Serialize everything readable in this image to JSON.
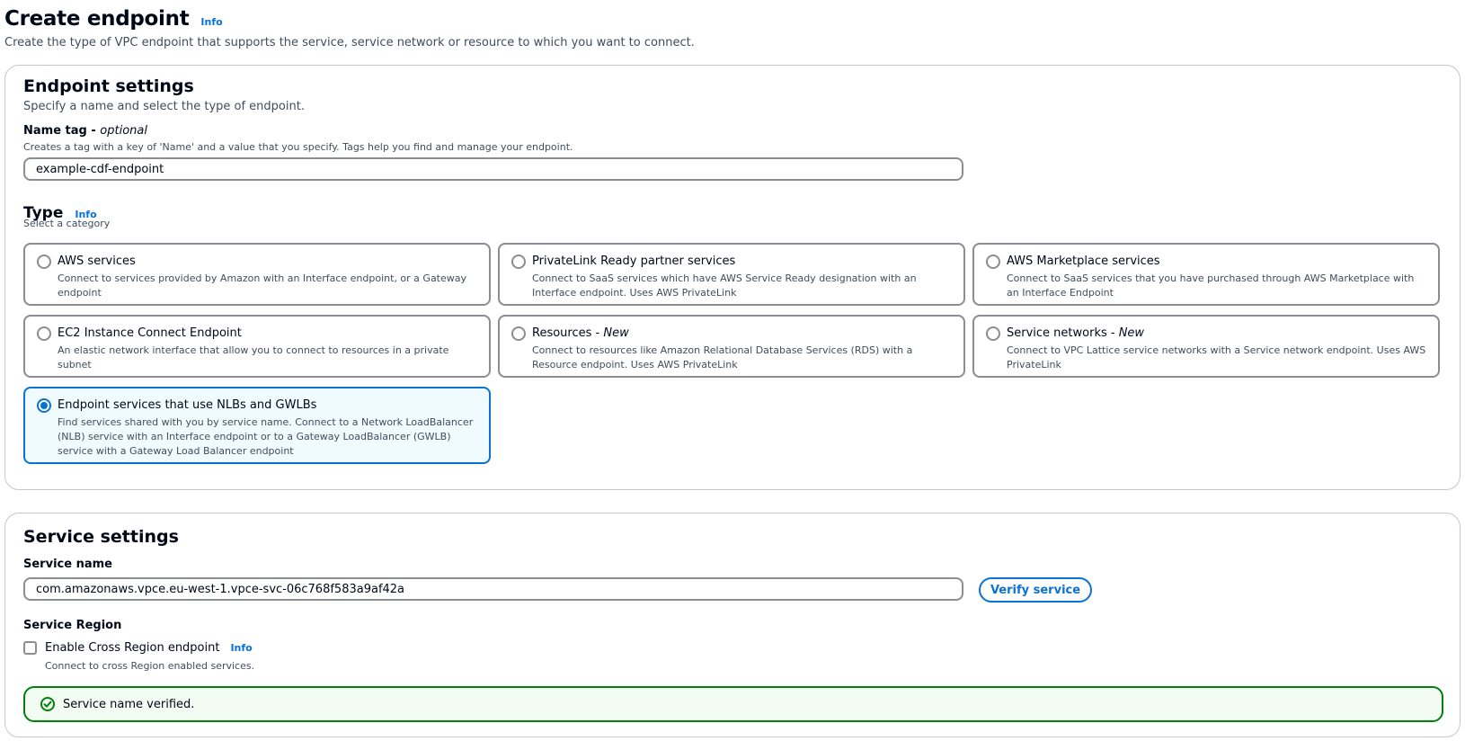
{
  "page": {
    "title": "Create endpoint",
    "info": "Info",
    "description": "Create the type of VPC endpoint that supports the service, service network or resource to which you want to connect."
  },
  "endpoint_settings": {
    "title": "Endpoint settings",
    "description": "Specify a name and select the type of endpoint.",
    "name_tag": {
      "label": "Name tag - ",
      "label_optional": "optional",
      "hint": "Creates a tag with a key of 'Name' and a value that you specify. Tags help you find and manage your endpoint.",
      "value": "example-cdf-endpoint"
    },
    "type": {
      "title": "Type",
      "info": "Info",
      "subtitle": "Select a category",
      "options": [
        {
          "label": "AWS services",
          "label_suffix": "",
          "description": "Connect to services provided by Amazon with an Interface endpoint, or a Gateway endpoint",
          "selected": false
        },
        {
          "label": "PrivateLink Ready partner services",
          "label_suffix": "",
          "description": "Connect to SaaS services which have AWS Service Ready designation with an Interface endpoint. Uses AWS PrivateLink",
          "selected": false
        },
        {
          "label": "AWS Marketplace services",
          "label_suffix": "",
          "description": "Connect to SaaS services that you have purchased through AWS Marketplace with an Interface Endpoint",
          "selected": false
        },
        {
          "label": "EC2 Instance Connect Endpoint",
          "label_suffix": "",
          "description": "An elastic network interface that allow you to connect to resources in a private subnet",
          "selected": false
        },
        {
          "label": "Resources - ",
          "label_suffix": "New",
          "description": "Connect to resources like Amazon Relational Database Services (RDS) with a Resource endpoint. Uses AWS PrivateLink",
          "selected": false
        },
        {
          "label": "Service networks - ",
          "label_suffix": "New",
          "description": "Connect to VPC Lattice service networks with a Service network endpoint. Uses AWS PrivateLink",
          "selected": false
        },
        {
          "label": "Endpoint services that use NLBs and GWLBs",
          "label_suffix": "",
          "description": "Find services shared with you by service name. Connect to a Network LoadBalancer (NLB) service with an Interface endpoint or to a Gateway LoadBalancer (GWLB) service with a Gateway Load Balancer endpoint",
          "selected": true
        }
      ]
    }
  },
  "service_settings": {
    "title": "Service settings",
    "service_name": {
      "label": "Service name",
      "value": "com.amazonaws.vpce.eu-west-1.vpce-svc-06c768f583a9af42a"
    },
    "verify_button": "Verify service",
    "service_region": {
      "label": "Service Region",
      "checkbox_label": "Enable Cross Region endpoint",
      "info": "Info",
      "hint": "Connect to cross Region enabled services.",
      "checked": false
    },
    "alert": {
      "text": "Service name verified.",
      "icon": "check-circle-icon"
    }
  },
  "colors": {
    "link": "#0972d3",
    "success": "#037f0c",
    "border": "#8c8c94"
  }
}
